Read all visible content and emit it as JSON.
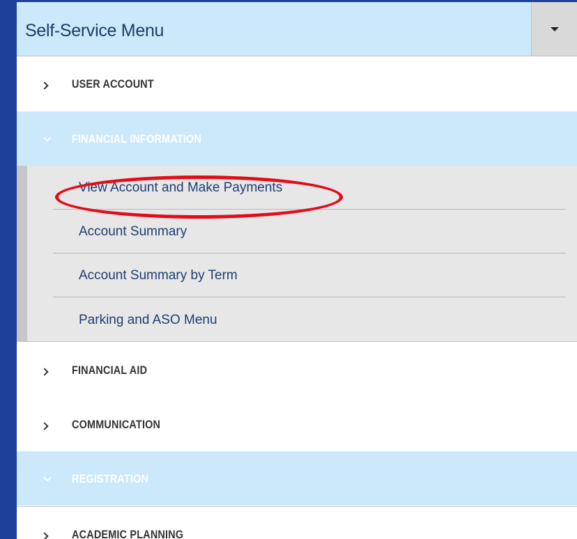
{
  "menu": {
    "title": "Self-Service Menu",
    "sections": [
      {
        "label": "USER ACCOUNT",
        "expanded": false
      },
      {
        "label": "FINANCIAL INFORMATION",
        "expanded": true
      },
      {
        "label": "FINANCIAL AID",
        "expanded": false
      },
      {
        "label": "COMMUNICATION",
        "expanded": false
      },
      {
        "label": "REGISTRATION",
        "expanded": true
      },
      {
        "label": "ACADEMIC PLANNING",
        "expanded": false
      }
    ],
    "financial_items": [
      "View Account and Make Payments",
      "Account Summary",
      "Account Summary by Term",
      "Parking and ASO Menu"
    ]
  },
  "colors": {
    "background": "#1e3f9a",
    "header": "#cbe9fb",
    "highlight": "#e30b17"
  },
  "icons": {
    "toggle": "caret-down-icon",
    "collapsed": "chevron-right-icon",
    "expanded": "chevron-down-icon"
  }
}
